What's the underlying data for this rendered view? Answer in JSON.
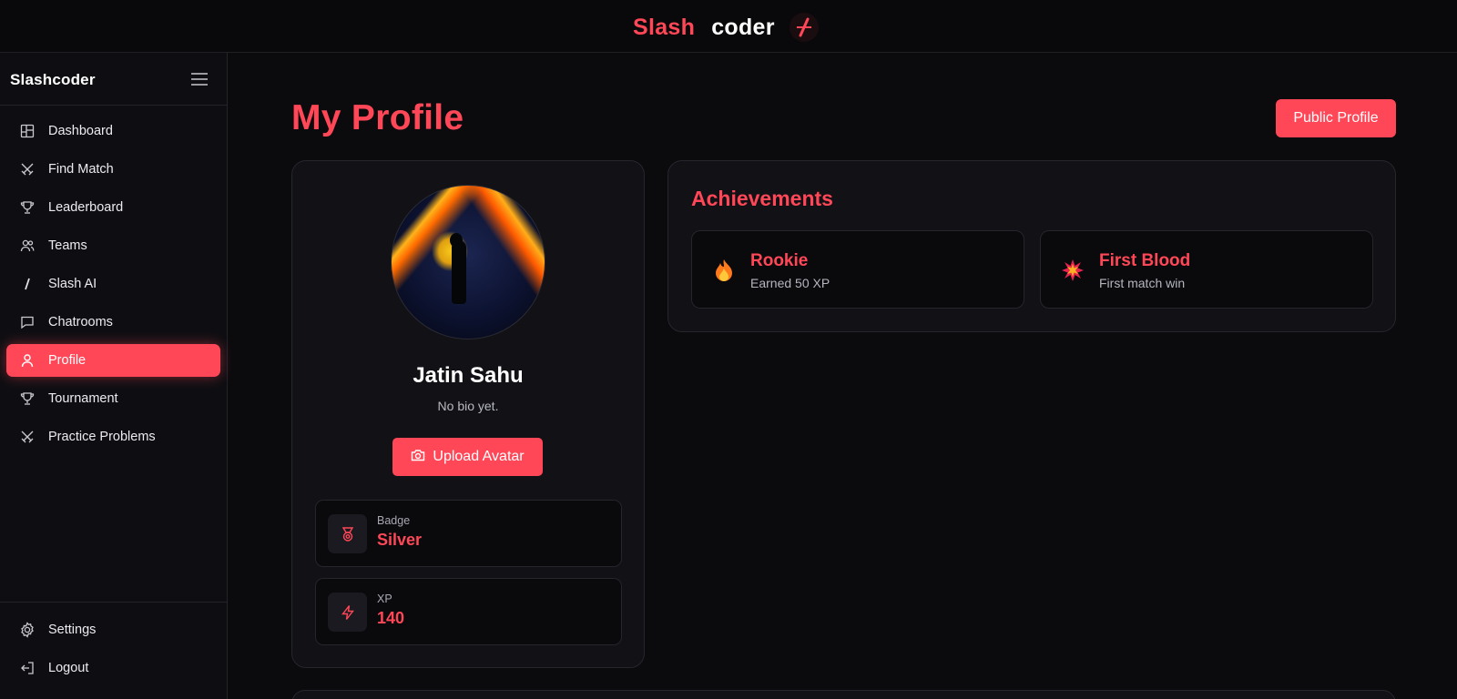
{
  "header": {
    "brand_part1": "Slash",
    "brand_part2": "coder",
    "logo_icon": "slash-logo-icon"
  },
  "sidebar": {
    "title": "Slashcoder",
    "items": [
      {
        "label": "Dashboard",
        "icon": "dashboard-icon"
      },
      {
        "label": "Find Match",
        "icon": "swords-icon"
      },
      {
        "label": "Leaderboard",
        "icon": "trophy-icon"
      },
      {
        "label": "Teams",
        "icon": "users-icon"
      },
      {
        "label": "Slash AI",
        "icon": "slash-icon"
      },
      {
        "label": "Chatrooms",
        "icon": "chat-icon"
      },
      {
        "label": "Profile",
        "icon": "user-icon",
        "active": true
      },
      {
        "label": "Tournament",
        "icon": "trophy-icon"
      },
      {
        "label": "Practice Problems",
        "icon": "swords-icon"
      }
    ],
    "bottom": [
      {
        "label": "Settings",
        "icon": "gear-icon"
      },
      {
        "label": "Logout",
        "icon": "logout-icon"
      }
    ]
  },
  "main": {
    "title": "My Profile",
    "public_profile_label": "Public Profile",
    "profile": {
      "name": "Jatin Sahu",
      "bio": "No bio yet.",
      "upload_label": "Upload Avatar",
      "stats": [
        {
          "label": "Badge",
          "value": "Silver",
          "icon": "medal-icon"
        },
        {
          "label": "XP",
          "value": "140",
          "icon": "lightning-icon"
        }
      ]
    },
    "achievements": {
      "title": "Achievements",
      "items": [
        {
          "name": "Rookie",
          "desc": "Earned 50 XP",
          "icon": "fire-icon"
        },
        {
          "name": "First Blood",
          "desc": "First match win",
          "icon": "explosion-icon"
        }
      ]
    }
  },
  "colors": {
    "accent": "#ff4757",
    "background": "#0b0b0e",
    "card": "#111116"
  }
}
